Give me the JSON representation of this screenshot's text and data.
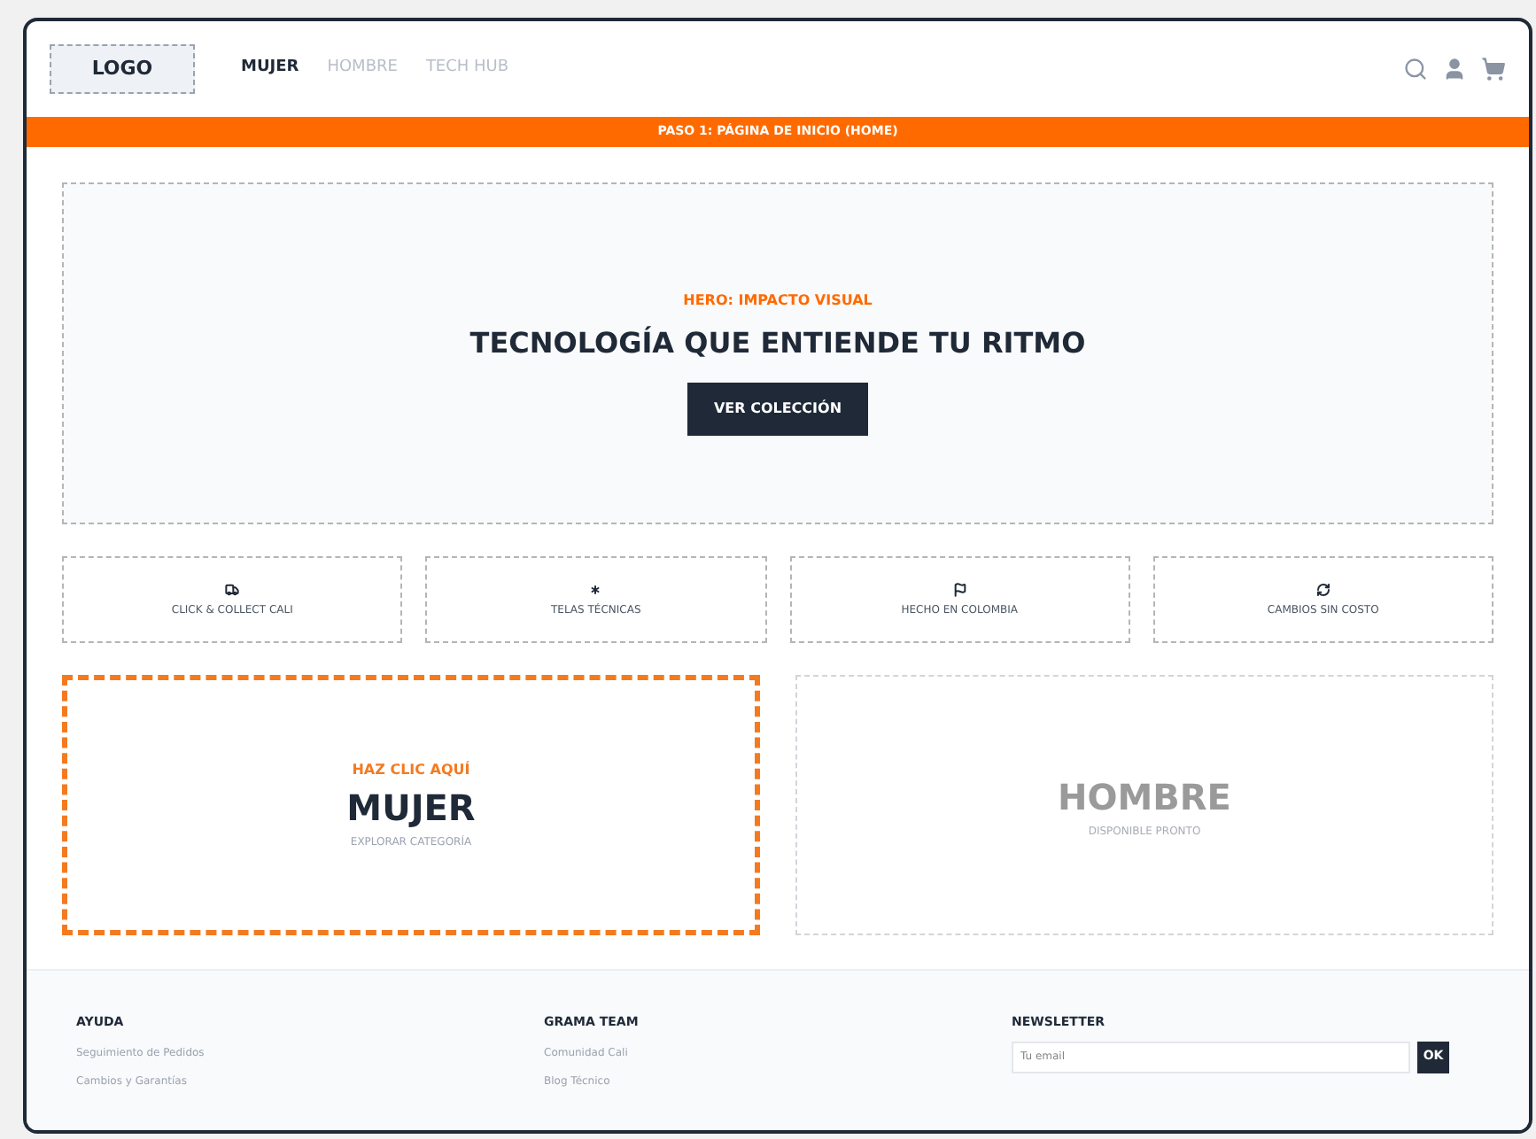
{
  "header": {
    "logo": "LOGO",
    "nav": [
      {
        "label": "MUJER",
        "selected": true
      },
      {
        "label": "HOMBRE",
        "selected": false
      },
      {
        "label": "TECH HUB",
        "selected": false
      }
    ]
  },
  "step_banner": "PASO 1: PÁGINA DE INICIO (HOME)",
  "hero": {
    "eyebrow": "HERO: IMPACTO VISUAL",
    "title": "TECNOLOGÍA QUE ENTIENDE TU RITMO",
    "button": "VER COLECCIÓN"
  },
  "features": [
    {
      "kind": "truck",
      "label": "CLICK & COLLECT CALI"
    },
    {
      "kind": "asterisk",
      "label": "TELAS TÉCNICAS"
    },
    {
      "kind": "flag",
      "label": "HECHO EN COLOMBIA"
    },
    {
      "kind": "refresh",
      "label": "CAMBIOS SIN COSTO"
    }
  ],
  "categories": [
    {
      "hint": "HAZ CLIC AQUÍ",
      "title": "MUJER",
      "subtitle": "EXPLORAR CATEGORÍA",
      "available": true
    },
    {
      "title": "HOMBRE",
      "subtitle": "DISPONIBLE PRONTO",
      "available": false
    }
  ],
  "footer": {
    "columns": [
      {
        "heading": "AYUDA",
        "links": [
          "Seguimiento de Pedidos",
          "Cambios y Garantías"
        ]
      },
      {
        "heading": "GRAMA TEAM",
        "links": [
          "Comunidad Cali",
          "Blog Técnico"
        ]
      }
    ],
    "newsletter": {
      "heading": "NEWSLETTER",
      "placeholder": "Tu email",
      "button": "OK"
    }
  }
}
